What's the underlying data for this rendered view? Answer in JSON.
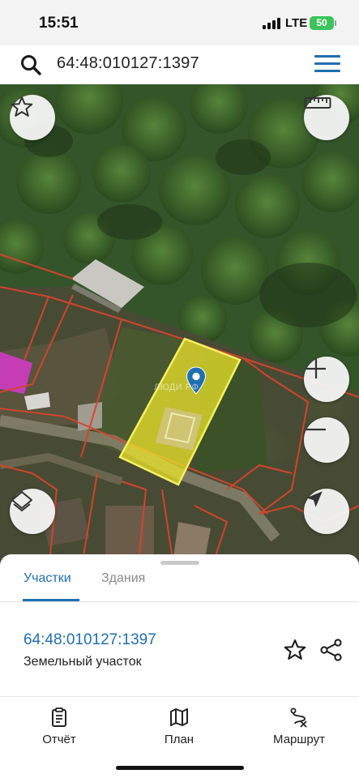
{
  "status_bar": {
    "time": "15:51",
    "network": "LTE",
    "battery": "50"
  },
  "search": {
    "query": "64:48:010127:1397"
  },
  "map": {
    "watermark": "ЛЮДИ РФ",
    "controls": [
      "star-icon",
      "ruler-icon",
      "zoom-in-icon",
      "zoom-out-icon",
      "layers-icon",
      "locate-icon"
    ],
    "colors": {
      "parcel_fill": "#f2ea2a",
      "parcel_border": "#f4f060",
      "boundary_lines": "#d8442c",
      "marker": "#1f6fb2"
    }
  },
  "sheet": {
    "tabs": [
      {
        "label": "Участки",
        "active": true
      },
      {
        "label": "Здания",
        "active": false
      }
    ],
    "result": {
      "cadastral_number": "64:48:010127:1397",
      "type": "Земельный участок"
    }
  },
  "bottom_nav": [
    {
      "label": "Отчёт",
      "icon": "report-icon"
    },
    {
      "label": "План",
      "icon": "map-plan-icon"
    },
    {
      "label": "Маршрут",
      "icon": "route-icon"
    }
  ]
}
